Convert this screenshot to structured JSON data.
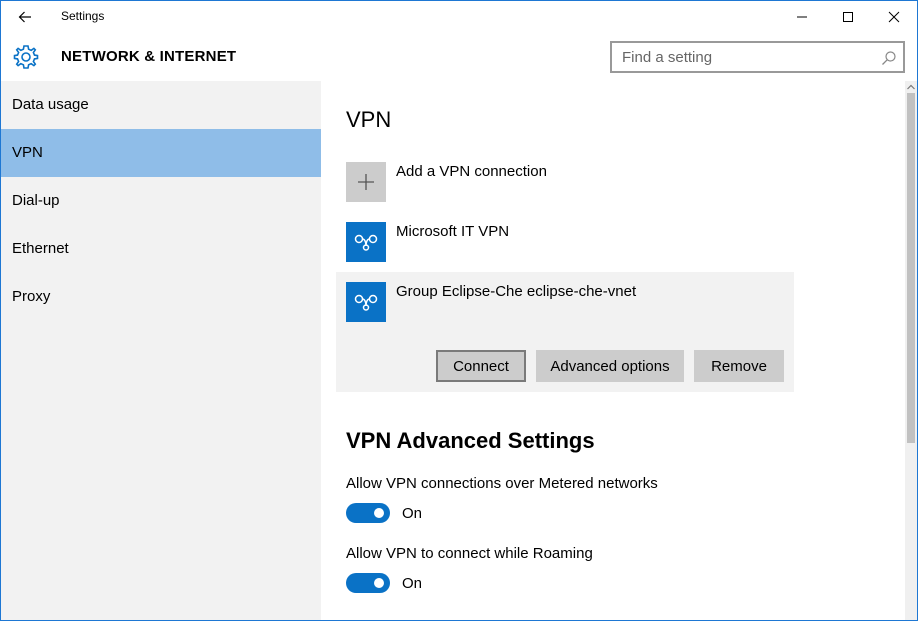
{
  "window": {
    "title": "Settings"
  },
  "header": {
    "section_title": "NETWORK & INTERNET",
    "search": {
      "placeholder": "Find a setting"
    }
  },
  "sidebar": {
    "items": [
      {
        "label": "Data usage",
        "selected": false
      },
      {
        "label": "VPN",
        "selected": true
      },
      {
        "label": "Dial-up",
        "selected": false
      },
      {
        "label": "Ethernet",
        "selected": false
      },
      {
        "label": "Proxy",
        "selected": false
      }
    ]
  },
  "main": {
    "vpn_heading": "VPN",
    "add_connection_label": "Add a VPN connection",
    "connections": [
      {
        "name": "Microsoft IT VPN"
      },
      {
        "name": "Group Eclipse-Che eclipse-che-vnet"
      }
    ],
    "actions": {
      "connect": "Connect",
      "advanced": "Advanced options",
      "remove": "Remove"
    },
    "advanced_heading": "VPN Advanced Settings",
    "settings": [
      {
        "label": "Allow VPN connections over Metered networks",
        "state": "On"
      },
      {
        "label": "Allow VPN to connect while Roaming",
        "state": "On"
      }
    ]
  },
  "colors": {
    "accent": "#0a72c6",
    "selected_nav": "#8fbde8",
    "sidebar_bg": "#f2f2f2",
    "button_bg": "#cccccc"
  },
  "icons": {
    "back": "back-arrow-icon",
    "settings": "gear-icon",
    "search": "search-icon",
    "add": "plus-icon",
    "vpn": "vpn-icon"
  }
}
